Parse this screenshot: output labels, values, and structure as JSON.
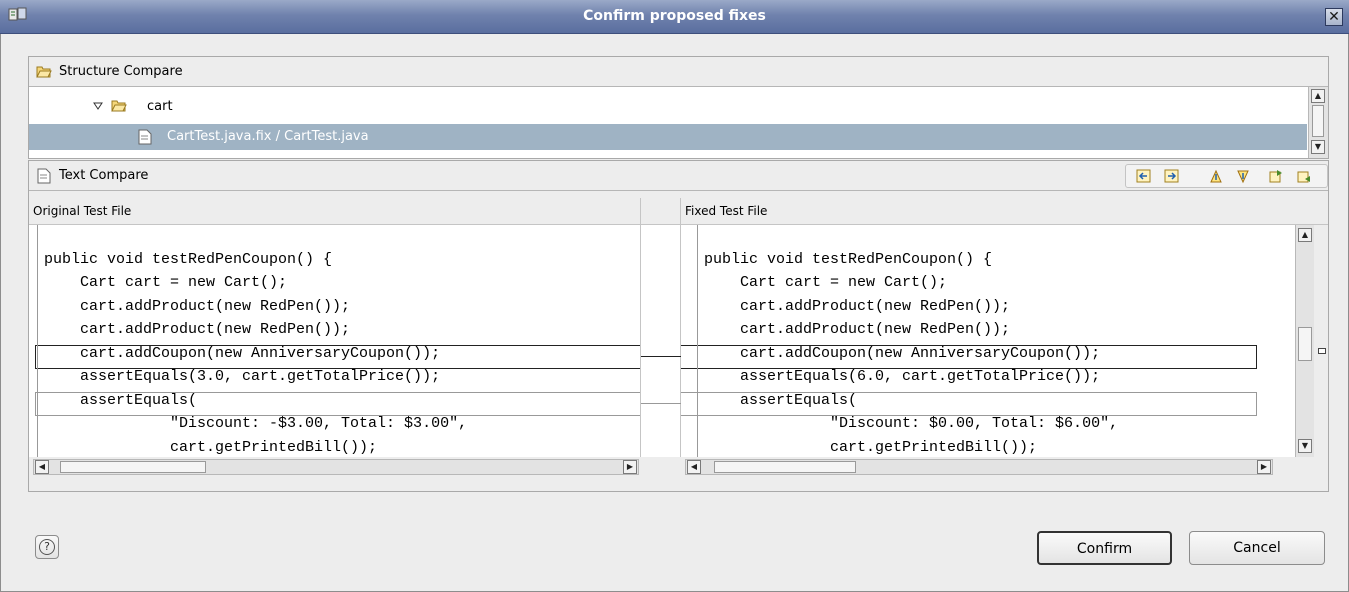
{
  "window": {
    "title": "Confirm proposed fixes",
    "close_label": "✕"
  },
  "structure": {
    "header": "Structure Compare",
    "folder": "cart",
    "file": "CartTest.java.fix / CartTest.java"
  },
  "text_compare": {
    "header": "Text Compare",
    "left_title": "Original Test File",
    "right_title": "Fixed Test File",
    "left_lines": [
      " public void testRedPenCoupon() {",
      "     Cart cart = new Cart();",
      "     cart.addProduct(new RedPen());",
      "     cart.addProduct(new RedPen());",
      "     cart.addCoupon(new AnniversaryCoupon());",
      "     assertEquals(3.0, cart.getTotalPrice());",
      "     assertEquals(",
      "               \"Discount: -$3.00, Total: $3.00\",",
      "               cart.getPrintedBill());",
      " }"
    ],
    "right_lines": [
      " public void testRedPenCoupon() {",
      "     Cart cart = new Cart();",
      "     cart.addProduct(new RedPen());",
      "     cart.addProduct(new RedPen());",
      "     cart.addCoupon(new AnniversaryCoupon());",
      "     assertEquals(6.0, cart.getTotalPrice());",
      "     assertEquals(",
      "               \"Discount: $0.00, Total: $6.00\",",
      "               cart.getPrintedBill());",
      " }"
    ]
  },
  "buttons": {
    "help": "?",
    "confirm": "Confirm",
    "cancel": "Cancel"
  }
}
